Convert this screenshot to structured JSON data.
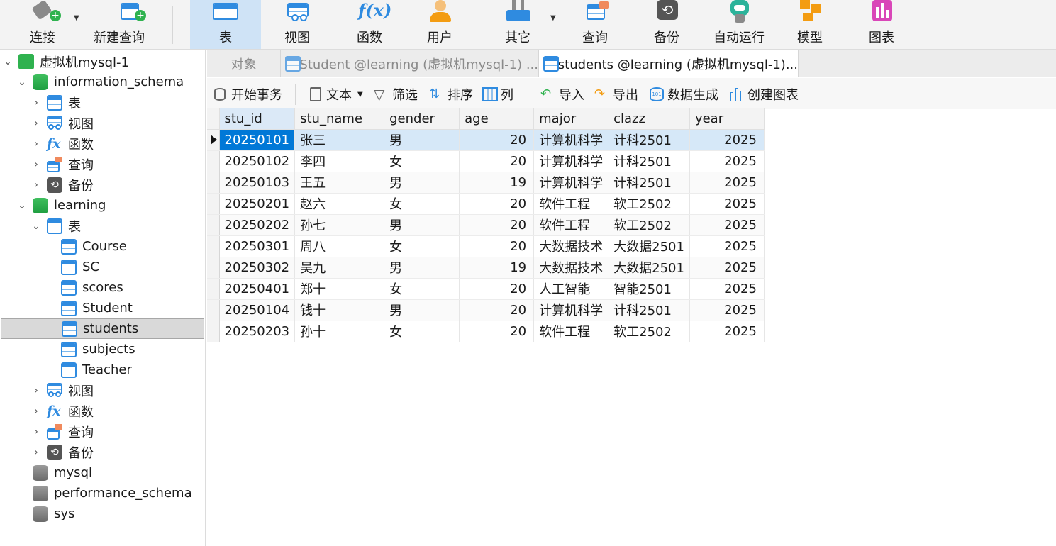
{
  "toolbar": {
    "connect": "连接",
    "new_query": "新建查询",
    "table": "表",
    "view": "视图",
    "function": "函数",
    "user": "用户",
    "other": "其它",
    "query": "查询",
    "backup": "备份",
    "autorun": "自动运行",
    "model": "模型",
    "chart": "图表"
  },
  "sidebar": {
    "connection": "虚拟机mysql-1",
    "db_info": "information_schema",
    "db_learning": "learning",
    "node_table": "表",
    "node_view": "视图",
    "node_function": "函数",
    "node_query": "查询",
    "node_backup": "备份",
    "tables": [
      "Course",
      "SC",
      "scores",
      "Student",
      "students",
      "subjects",
      "Teacher"
    ],
    "db_mysql": "mysql",
    "db_perf": "performance_schema",
    "db_sys": "sys"
  },
  "tabs": {
    "objects": "对象",
    "tab1": "Student @learning (虚拟机mysql-1) ...",
    "tab2": "students @learning (虚拟机mysql-1)..."
  },
  "objbar": {
    "begin_tx": "开始事务",
    "text": "文本",
    "filter": "筛选",
    "sort": "排序",
    "columns": "列",
    "import": "导入",
    "export": "导出",
    "datagen": "数据生成",
    "create_chart": "创建图表"
  },
  "grid": {
    "columns": [
      "stu_id",
      "stu_name",
      "gender",
      "age",
      "major",
      "clazz",
      "year"
    ],
    "rows": [
      [
        "20250101",
        "张三",
        "男",
        "20",
        "计算机科学",
        "计科2501",
        "2025"
      ],
      [
        "20250102",
        "李四",
        "女",
        "20",
        "计算机科学",
        "计科2501",
        "2025"
      ],
      [
        "20250103",
        "王五",
        "男",
        "19",
        "计算机科学",
        "计科2501",
        "2025"
      ],
      [
        "20250201",
        "赵六",
        "女",
        "20",
        "软件工程",
        "软工2502",
        "2025"
      ],
      [
        "20250202",
        "孙七",
        "男",
        "20",
        "软件工程",
        "软工2502",
        "2025"
      ],
      [
        "20250301",
        "周八",
        "女",
        "20",
        "大数据技术",
        "大数据2501",
        "2025"
      ],
      [
        "20250302",
        "吴九",
        "男",
        "19",
        "大数据技术",
        "大数据2501",
        "2025"
      ],
      [
        "20250401",
        "郑十",
        "女",
        "20",
        "人工智能",
        "智能2501",
        "2025"
      ],
      [
        "20250104",
        "钱十",
        "男",
        "20",
        "计算机科学",
        "计科2501",
        "2025"
      ],
      [
        "20250203",
        "孙十",
        "女",
        "20",
        "软件工程",
        "软工2502",
        "2025"
      ]
    ]
  },
  "colors": {
    "accent": "#2f8be0",
    "selected_cell": "#0078d7",
    "selected_row": "#d6e8f8",
    "db_green": "#2fb24f"
  }
}
